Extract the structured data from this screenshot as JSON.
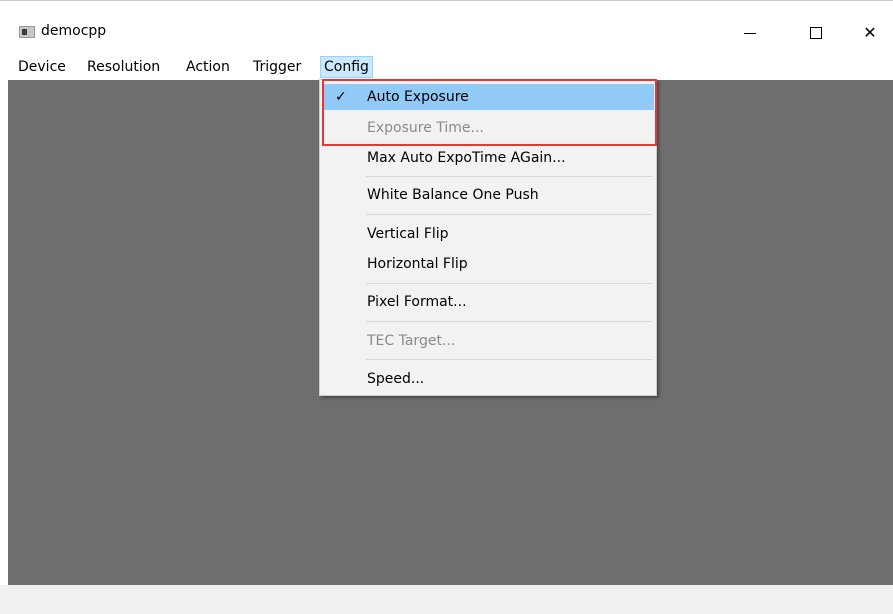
{
  "window": {
    "title": "democpp",
    "minimize_glyph": "—",
    "maximize_glyph": "☐",
    "close_glyph": "✕"
  },
  "menubar": {
    "items": [
      {
        "label": "Device"
      },
      {
        "label": "Resolution"
      },
      {
        "label": "Action"
      },
      {
        "label": "Trigger"
      },
      {
        "label": "Config",
        "active": true
      }
    ]
  },
  "config_menu": {
    "items": [
      {
        "label": "Auto Exposure",
        "checked": true,
        "enabled": true,
        "highlighted": true
      },
      {
        "label": "Exposure Time...",
        "enabled": false
      },
      {
        "label": "Max Auto ExpoTime AGain...",
        "enabled": true
      },
      {
        "label": "White Balance One Push",
        "enabled": true
      },
      {
        "label": "Vertical Flip",
        "enabled": true
      },
      {
        "label": "Horizontal Flip",
        "enabled": true
      },
      {
        "label": "Pixel Format...",
        "enabled": true
      },
      {
        "label": "TEC Target...",
        "enabled": false
      },
      {
        "label": "Speed...",
        "enabled": true
      }
    ],
    "check_glyph": "✓"
  },
  "colors": {
    "viewport": "#6e6e6e",
    "highlight": "#91c9f7",
    "annotation_box": "#e53935"
  }
}
